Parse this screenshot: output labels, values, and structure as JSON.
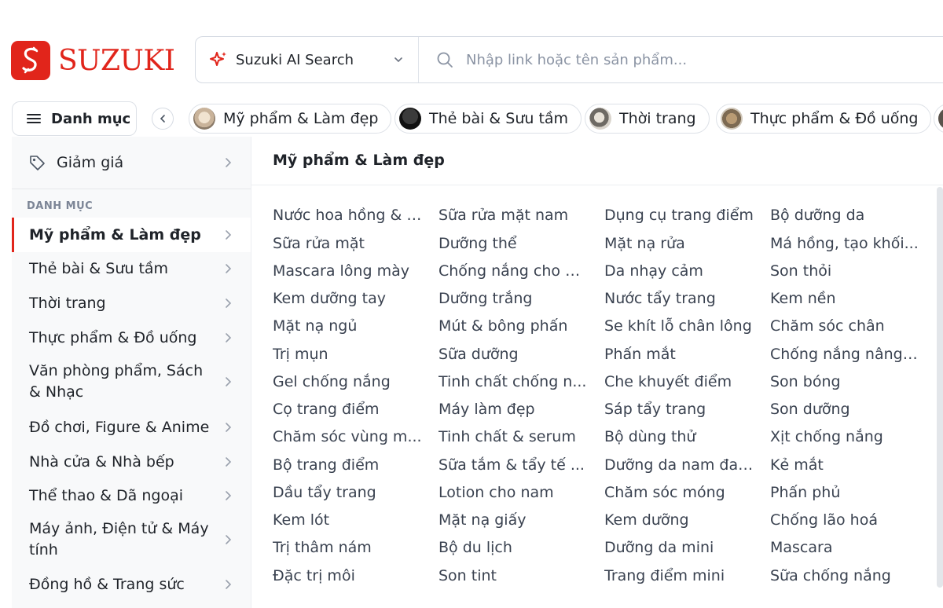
{
  "brand": {
    "name": "SUZUKI",
    "color": "#e1251b"
  },
  "search": {
    "ai_label": "Suzuki AI Search",
    "placeholder": "Nhập link hoặc tên sản phẩm..."
  },
  "category_button": {
    "label": "Danh mục"
  },
  "chips": [
    {
      "label": "Mỹ phẩm & Làm đẹp"
    },
    {
      "label": "Thẻ bài & Sưu tầm"
    },
    {
      "label": "Thời trang"
    },
    {
      "label": "Thực phẩm & Đồ uống"
    }
  ],
  "sidebar": {
    "discount_label": "Giảm giá",
    "section_title": "DANH MỤC",
    "items": [
      {
        "label": "Mỹ phẩm & Làm đẹp",
        "active": true
      },
      {
        "label": "Thẻ bài & Sưu tầm"
      },
      {
        "label": "Thời trang"
      },
      {
        "label": "Thực phẩm & Đồ uống"
      },
      {
        "label": "Văn phòng phẩm, Sách & Nhạc"
      },
      {
        "label": "Đồ chơi, Figure & Anime"
      },
      {
        "label": "Nhà cửa & Nhà bếp"
      },
      {
        "label": "Thể thao & Dã ngoại"
      },
      {
        "label": "Máy ảnh, Điện tử & Máy tính"
      },
      {
        "label": "Đồng hồ & Trang sức"
      }
    ]
  },
  "content": {
    "title": "Mỹ phẩm & Làm đẹp",
    "columns": [
      [
        "Nước hoa hồng & l...",
        "Sữa rửa mặt",
        "Mascara lông mày",
        "Kem dưỡng tay",
        "Mặt nạ ngủ",
        "Trị mụn",
        "Gel chống nắng",
        "Cọ trang điểm",
        "Chăm sóc vùng m...",
        "Bộ trang điểm",
        "Dầu tẩy trang",
        "Kem lót",
        "Trị thâm nám",
        "Đặc trị môi"
      ],
      [
        "Sữa rửa mặt nam",
        "Dưỡng thể",
        "Chống nắng cho n...",
        "Dưỡng trắng",
        "Mút & bông phấn",
        "Sữa dưỡng",
        "Tinh chất chống n...",
        "Máy làm đẹp",
        "Tinh chất & serum",
        "Sữa tắm & tẩy tế ...",
        "Lotion cho nam",
        "Mặt nạ giấy",
        "Bộ du lịch",
        "Son tint"
      ],
      [
        "Dụng cụ trang điểm",
        "Mặt nạ rửa",
        "Da nhạy cảm",
        "Nước tẩy trang",
        "Se khít lỗ chân lông",
        "Phấn mắt",
        "Che khuyết điểm",
        "Sáp tẩy trang",
        "Bộ dùng thử",
        "Dưỡng da nam đa ...",
        "Chăm sóc móng",
        "Kem dưỡng",
        "Dưỡng da mini",
        "Trang điểm mini"
      ],
      [
        "Bộ dưỡng da",
        "Má hồng, tạo khối...",
        "Son thỏi",
        "Kem nền",
        "Chăm sóc chân",
        "Chống nắng nâng ...",
        "Son bóng",
        "Son dưỡng",
        "Xịt chống nắng",
        "Kẻ mắt",
        "Phấn phủ",
        "Chống lão hoá",
        "Mascara",
        "Sữa chống nắng"
      ]
    ]
  }
}
